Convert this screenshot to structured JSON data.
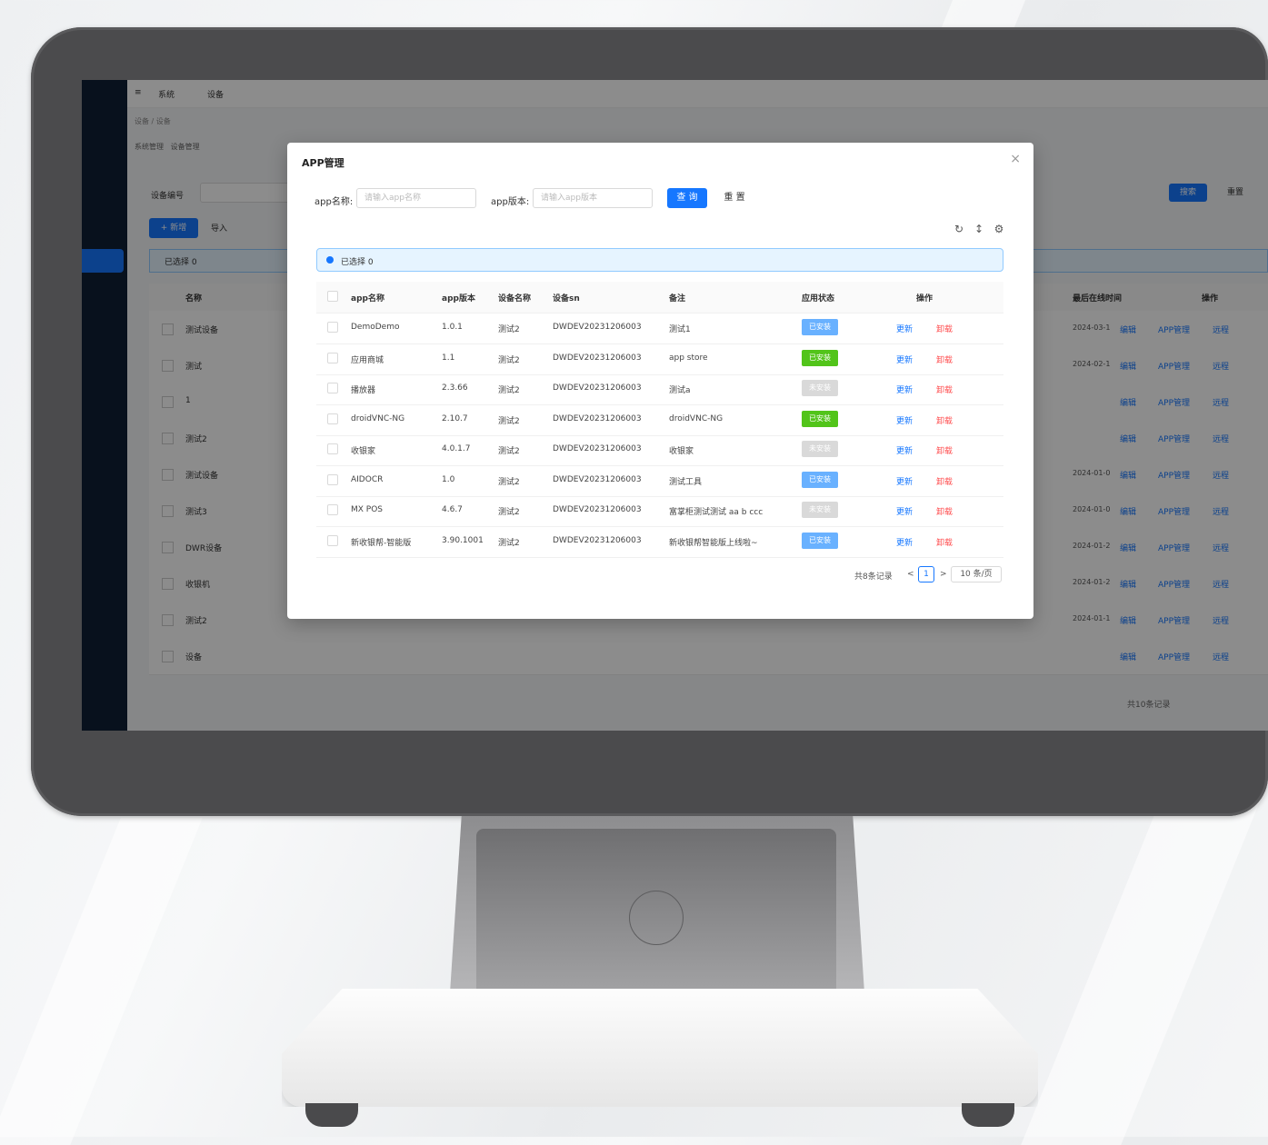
{
  "background_app": {
    "topbar": [
      "系统",
      "设备"
    ],
    "breadcrumb": [
      "设备",
      "设备"
    ],
    "tabs": [
      "系统管理",
      "设备管理"
    ],
    "search_label": "设备编号",
    "actions": {
      "add": "+ 新增",
      "import": "导入"
    },
    "alert": "已选择 0",
    "columns": [
      "名称",
      "最后在线时间",
      "操作"
    ],
    "rows": [
      {
        "name": "测试设备",
        "time": "2024-03-1",
        "link1": "编辑",
        "link2": "APP管理",
        "link3": "远程"
      },
      {
        "name": "测试",
        "time": "2024-02-1",
        "link1": "编辑",
        "link2": "APP管理",
        "link3": "远程"
      },
      {
        "name": "1",
        "time": "",
        "link1": "编辑",
        "link2": "APP管理",
        "link3": "远程"
      },
      {
        "name": "测试2",
        "time": "",
        "link1": "编辑",
        "link2": "APP管理",
        "link3": "远程"
      },
      {
        "name": "测试设备",
        "time": "2024-01-0",
        "link1": "编辑",
        "link2": "APP管理",
        "link3": "远程"
      },
      {
        "name": "测试3",
        "time": "2024-01-0",
        "link1": "编辑",
        "link2": "APP管理",
        "link3": "远程"
      },
      {
        "name": "DWR设备",
        "time": "2024-01-2",
        "link1": "编辑",
        "link2": "APP管理",
        "link3": "远程"
      },
      {
        "name": "收银机",
        "time": "2024-01-2",
        "link1": "编辑",
        "link2": "APP管理",
        "link3": "远程"
      },
      {
        "name": "测试2",
        "time": "2024-01-1",
        "link1": "编辑",
        "link2": "APP管理",
        "link3": "远程"
      },
      {
        "name": "设备",
        "time": "",
        "link1": "编辑",
        "link2": "APP管理",
        "link3": "远程"
      }
    ],
    "query_btn": "搜索",
    "reset_btn": "重置",
    "pager": "共10条记录"
  },
  "modal": {
    "title": "APP管理",
    "close": "×",
    "form": {
      "name_label": "app名称:",
      "name_placeholder": "请输入app名称",
      "version_label": "app版本:",
      "version_placeholder": "请输入app版本",
      "search_btn": "查 询",
      "reset_btn": "重 置"
    },
    "toolbar_icons": [
      "reload-icon",
      "column-height-icon",
      "setting-icon"
    ],
    "alert": "已选择 0",
    "columns": [
      "app名称",
      "app版本",
      "设备名称",
      "设备sn",
      "备注",
      "应用状态",
      "操作"
    ],
    "rows": [
      {
        "name": "DemoDemo",
        "version": "1.0.1",
        "device": "测试2",
        "sn": "DWDEV20231206003",
        "remark": "测试1",
        "status": "已安装",
        "status_color": "#69b1ff",
        "edit": "更新",
        "del": "卸载"
      },
      {
        "name": "应用商城",
        "version": "1.1",
        "device": "测试2",
        "sn": "DWDEV20231206003",
        "remark": "app store",
        "status": "已安装",
        "status_color": "#52c41a",
        "edit": "更新",
        "del": "卸载"
      },
      {
        "name": "播放器",
        "version": "2.3.66",
        "device": "测试2",
        "sn": "DWDEV20231206003",
        "remark": "测试a",
        "status": "未安装",
        "status_color": "#d9d9d9",
        "edit": "更新",
        "del": "卸载"
      },
      {
        "name": "droidVNC-NG",
        "version": "2.10.7",
        "device": "测试2",
        "sn": "DWDEV20231206003",
        "remark": "droidVNC-NG",
        "status": "已安装",
        "status_color": "#52c41a",
        "edit": "更新",
        "del": "卸载"
      },
      {
        "name": "收银家",
        "version": "4.0.1.7",
        "device": "测试2",
        "sn": "DWDEV20231206003",
        "remark": "收银家",
        "status": "未安装",
        "status_color": "#d9d9d9",
        "edit": "更新",
        "del": "卸载"
      },
      {
        "name": "AIDOCR",
        "version": "1.0",
        "device": "测试2",
        "sn": "DWDEV20231206003",
        "remark": "测试工具",
        "status": "已安装",
        "status_color": "#69b1ff",
        "edit": "更新",
        "del": "卸载"
      },
      {
        "name": "MX POS",
        "version": "4.6.7",
        "device": "测试2",
        "sn": "DWDEV20231206003",
        "remark": "富掌柜测试测试 aa b ccc",
        "status": "未安装",
        "status_color": "#d9d9d9",
        "edit": "更新",
        "del": "卸载"
      },
      {
        "name": "新收银帮-智能版",
        "version": "3.90.1001",
        "device": "测试2",
        "sn": "DWDEV20231206003",
        "remark": "新收银帮智能版上线啦~",
        "status": "已安装",
        "status_color": "#69b1ff",
        "edit": "更新",
        "del": "卸载"
      }
    ],
    "pagination": {
      "total": "共8条记录",
      "page": "1",
      "size": "10 条/页",
      "prev": "<",
      "next": ">"
    }
  },
  "colors": {
    "primary": "#1677ff",
    "danger": "#ff4d4f",
    "sider": "#0f1f35",
    "bezel": "#4b4b4d"
  }
}
